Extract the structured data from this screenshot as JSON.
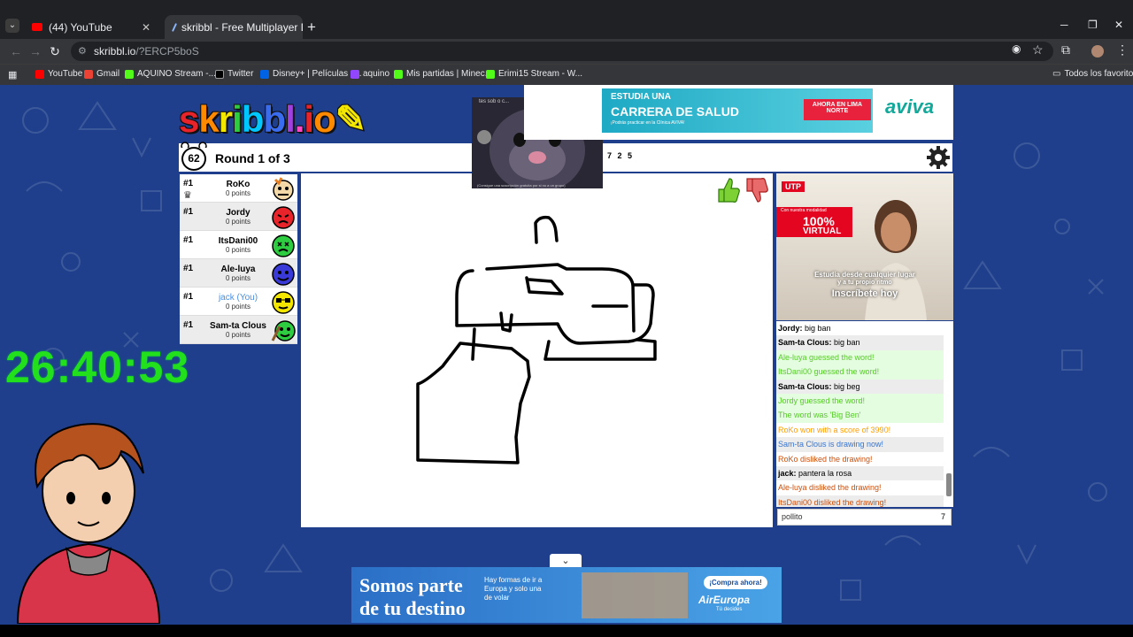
{
  "browser": {
    "tabs": [
      {
        "label": "(44) YouTube",
        "close": "✕"
      },
      {
        "label": "skribbl - Free Multiplayer Drawi",
        "close": "✕"
      }
    ],
    "new_tab": "+",
    "url_host": "skribbl.io",
    "url_path": "/?ERCP5boS",
    "bookmarks": [
      "YouTube",
      "Gmail",
      "AQUINO Stream -...",
      "Twitter",
      "Disney+ | Películas y...",
      "aquino",
      "Mis partidas | Minec...",
      "Erimi15 Stream - W..."
    ],
    "all_bookmarks": "Todos los favoritos"
  },
  "game": {
    "logo": "skribbl.io",
    "time_left": "62",
    "round": "Round 1 of 3",
    "word_hint": "7 2 5",
    "players": [
      {
        "rank": "#1",
        "name": "RoKo",
        "points": "0 points",
        "color": "#f4d9a8",
        "crown": true
      },
      {
        "rank": "#1",
        "name": "Jordy",
        "points": "0 points",
        "color": "#e8232a"
      },
      {
        "rank": "#1",
        "name": "ItsDani00",
        "points": "0 points",
        "color": "#2ecc40"
      },
      {
        "rank": "#1",
        "name": "Ale-luya",
        "points": "0 points",
        "color": "#3a3ad8"
      },
      {
        "rank": "#1",
        "name": "jack (You)",
        "points": "0 points",
        "color": "#f3e600",
        "you": true
      },
      {
        "rank": "#1",
        "name": "Sam-ta Clous",
        "points": "0 points",
        "color": "#2ecc40",
        "drawing": true
      }
    ],
    "chat": [
      {
        "name": "Jordy:",
        "text": "big ban",
        "type": "normal"
      },
      {
        "name": "Sam-ta Clous:",
        "text": "big ban",
        "type": "normal"
      },
      {
        "text": "Ale-luya guessed the word!",
        "type": "green"
      },
      {
        "text": "ItsDani00 guessed the word!",
        "type": "green"
      },
      {
        "name": "Sam-ta Clous:",
        "text": "big beg",
        "type": "normal"
      },
      {
        "text": "Jordy guessed the word!",
        "type": "green"
      },
      {
        "text": "The word was 'Big Ben'",
        "type": "green"
      },
      {
        "text": "RoKo won with a score of 3990!",
        "type": "orange"
      },
      {
        "text": "Sam-ta Clous is drawing now!",
        "type": "blue"
      },
      {
        "text": "RoKo disliked the drawing!",
        "type": "red"
      },
      {
        "name": "jack:",
        "text": "pantera la rosa",
        "type": "normal"
      },
      {
        "text": "Ale-luya disliked the drawing!",
        "type": "red"
      },
      {
        "text": "ItsDani00 disliked the drawing!",
        "type": "red"
      }
    ],
    "chat_input_value": "pollito",
    "chat_input_count": "7"
  },
  "stream": {
    "clock": "26:40:53",
    "webcam_caption_top": "tes sob   o c...",
    "webcam_caption_bottom": "(Consigue una suscripción gratuita por si no a un grupo)"
  },
  "ads": {
    "top": {
      "line1": "ESTUDIA UNA",
      "line2": "CARRERA DE SALUD",
      "line3": "¡Podrás practicar en la Clínica AVIVA!",
      "cta": "AHORA EN LIMA NORTE",
      "brand": "aviva"
    },
    "side": {
      "brand": "UTP",
      "line_a": "Con nuestra modalidad",
      "line_b": "100%",
      "line_c": "VIRTUAL",
      "s1": "Estudia desde cualquier lugar",
      "s2": "y a tu propio ritmo",
      "s3": "Inscríbete hoy"
    },
    "bottom": {
      "h1": "Somos parte",
      "h2": "de tu destino",
      "body": "Hay formas de ir a Europa y solo una de volar",
      "cta": "¡Compra ahora!",
      "brand": "AirEuropa",
      "brand_sub": "Tú decides"
    }
  }
}
